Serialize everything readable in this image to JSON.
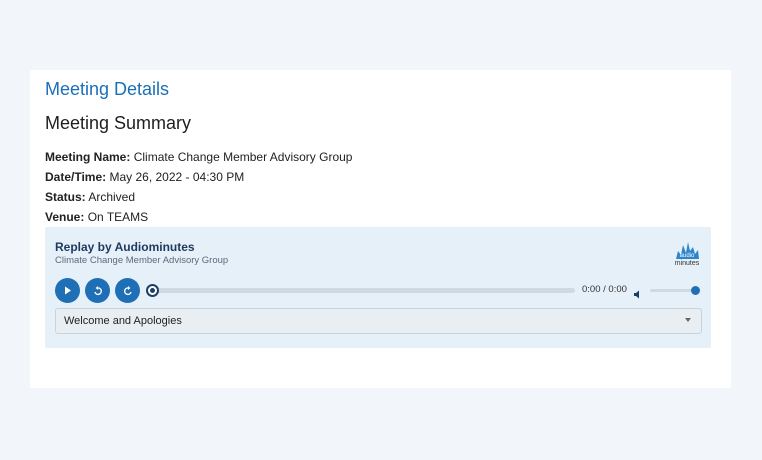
{
  "page": {
    "title": "Meeting Details"
  },
  "summary": {
    "heading": "Meeting Summary",
    "fields": [
      {
        "label": "Meeting Name:",
        "value": "Climate Change Member Advisory Group"
      },
      {
        "label": "Date/Time:",
        "value": "May 26, 2022 - 04:30 PM"
      },
      {
        "label": "Status:",
        "value": "Archived"
      },
      {
        "label": "Venue:",
        "value": "On TEAMS"
      }
    ]
  },
  "player": {
    "title": "Replay by Audiominutes",
    "subtitle": "Climate Change Member Advisory Group",
    "logo_text": "minutes",
    "logo_mark_text": "audio",
    "time": "0:00 / 0:00",
    "progress": 0,
    "volume": 1,
    "chapter_selected": "Welcome and Apologies",
    "icons": {
      "play": "play-icon",
      "rewind": "rewind-icon",
      "forward": "forward-icon",
      "volume": "volume-icon",
      "dropdown": "chevron-down-icon"
    },
    "accent_color": "#1f6fb7"
  }
}
